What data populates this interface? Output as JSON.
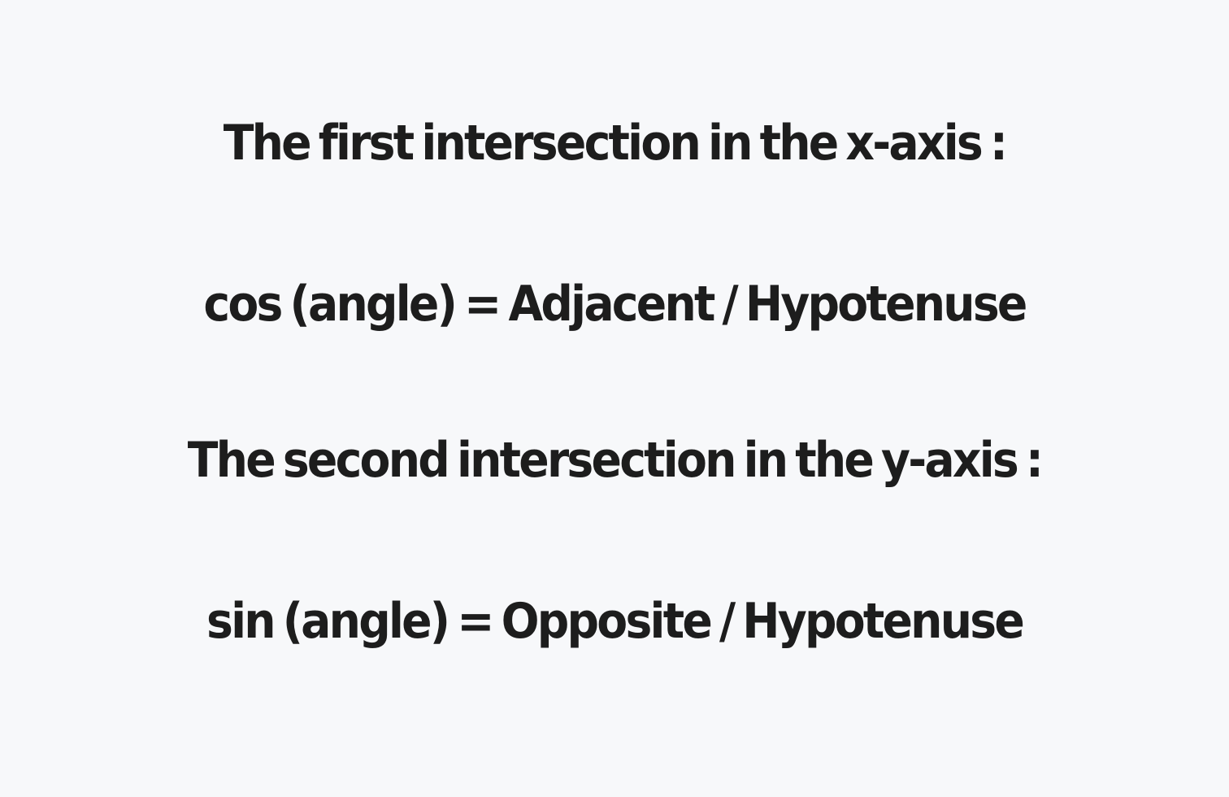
{
  "text_lines": [
    "The first intersection in the x-axis :",
    "cos (angle) = Adjacent / Hypotenuse",
    "The second intersection in the y-axis :",
    "sin (angle) = Opposite / Hypotenuse"
  ],
  "colors": {
    "background": "#f7f8fa",
    "text": "#1d1d1d"
  }
}
